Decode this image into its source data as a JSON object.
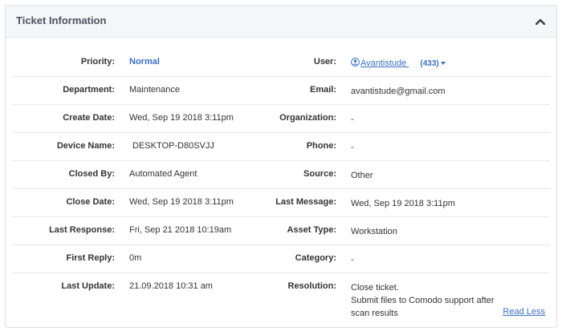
{
  "panel": {
    "title": "Ticket Information"
  },
  "left": [
    {
      "key": "priority",
      "label": "Priority:",
      "value": "Normal"
    },
    {
      "key": "department",
      "label": "Department:",
      "value": "Maintenance"
    },
    {
      "key": "create_date",
      "label": "Create Date:",
      "value": "Wed, Sep 19 2018 3:11pm"
    },
    {
      "key": "device_name",
      "label": "Device Name:",
      "value": "DESKTOP-D80SVJJ"
    },
    {
      "key": "closed_by",
      "label": "Closed By:",
      "value": "Automated Agent"
    },
    {
      "key": "close_date",
      "label": "Close Date:",
      "value": "Wed, Sep 19 2018 3:11pm"
    },
    {
      "key": "last_response",
      "label": "Last Response:",
      "value": "Fri, Sep 21 2018 10:19am"
    },
    {
      "key": "first_reply",
      "label": "First Reply:",
      "value": "0m"
    },
    {
      "key": "last_update",
      "label": "Last Update:",
      "value": "21.09.2018 10:31 am"
    }
  ],
  "right": {
    "user": {
      "label": "User:",
      "name": "Avantistude",
      "count": "(433)"
    },
    "email": {
      "label": "Email:",
      "value": "avantistude@gmail.com"
    },
    "organization": {
      "label": "Organization:",
      "value": "-"
    },
    "phone": {
      "label": "Phone:",
      "value": "-"
    },
    "source": {
      "label": "Source:",
      "value": "Other"
    },
    "last_message": {
      "label": "Last Message:",
      "value": "Wed, Sep 19 2018 3:11pm"
    },
    "asset_type": {
      "label": "Asset Type:",
      "value": "Workstation"
    },
    "category": {
      "label": "Category:",
      "value": "-"
    },
    "resolution": {
      "label": "Resolution:",
      "lines": [
        "Close ticket.",
        "Submit files to Comodo support after",
        "scan results"
      ],
      "read_less": "Read Less"
    }
  },
  "colors": {
    "link": "#3d6fbe",
    "header_bg": "#f5f6f8",
    "border": "#dcdfe3"
  },
  "icons": {
    "collapse": "chevron-up-icon",
    "user": "user-circle-icon",
    "count_dropdown": "caret-down-icon"
  }
}
